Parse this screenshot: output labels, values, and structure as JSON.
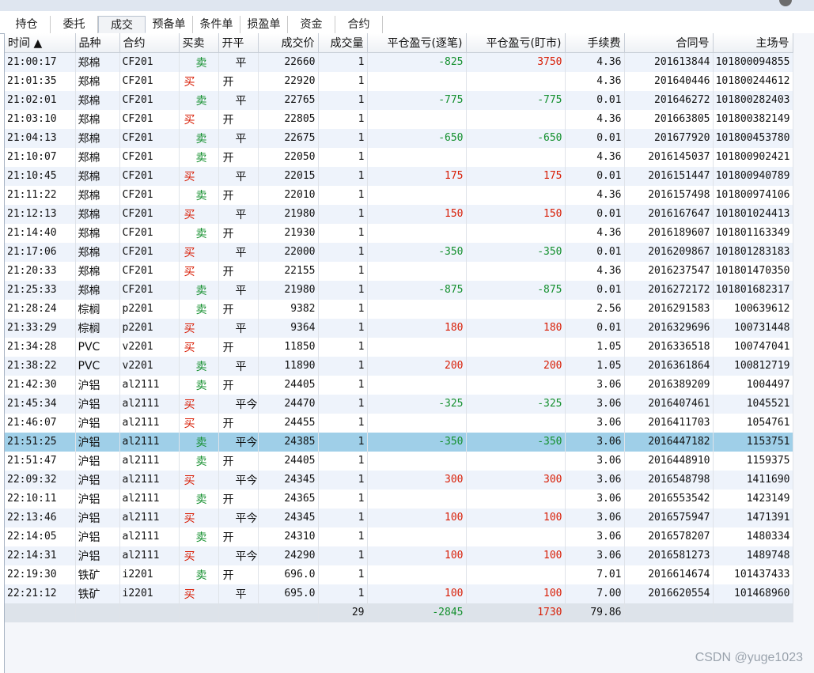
{
  "tabs": [
    {
      "label": "持仓",
      "active": false
    },
    {
      "label": "委托",
      "active": false
    },
    {
      "label": "成交",
      "active": true
    },
    {
      "label": "预备单",
      "active": false
    },
    {
      "label": "条件单",
      "active": false
    },
    {
      "label": "损盈单",
      "active": false
    },
    {
      "label": "资金",
      "active": false
    },
    {
      "label": "合约",
      "active": false
    }
  ],
  "columns": [
    "时间",
    "品种",
    "合约",
    "买卖",
    "开平",
    "成交价",
    "成交量",
    "平仓盈亏(逐笔)",
    "平仓盈亏(盯市)",
    "手续费",
    "合同号",
    "主场号"
  ],
  "sort_indicator": "▲",
  "rows": [
    {
      "time": "21:00:17",
      "symbol": "郑棉",
      "contract": "CF201",
      "side": "卖",
      "oc": "平",
      "price": "22660",
      "qty": "1",
      "pnl_trade": "-825",
      "pnl_mtm": "3750",
      "fee": "4.36",
      "order_id": "201613844",
      "exch_id": "101800094855"
    },
    {
      "time": "21:01:35",
      "symbol": "郑棉",
      "contract": "CF201",
      "side": "买",
      "oc": "开",
      "price": "22920",
      "qty": "1",
      "pnl_trade": "",
      "pnl_mtm": "",
      "fee": "4.36",
      "order_id": "201640446",
      "exch_id": "101800244612"
    },
    {
      "time": "21:02:01",
      "symbol": "郑棉",
      "contract": "CF201",
      "side": "卖",
      "oc": "平",
      "price": "22765",
      "qty": "1",
      "pnl_trade": "-775",
      "pnl_mtm": "-775",
      "fee": "0.01",
      "order_id": "201646272",
      "exch_id": "101800282403"
    },
    {
      "time": "21:03:10",
      "symbol": "郑棉",
      "contract": "CF201",
      "side": "买",
      "oc": "开",
      "price": "22805",
      "qty": "1",
      "pnl_trade": "",
      "pnl_mtm": "",
      "fee": "4.36",
      "order_id": "201663805",
      "exch_id": "101800382149"
    },
    {
      "time": "21:04:13",
      "symbol": "郑棉",
      "contract": "CF201",
      "side": "卖",
      "oc": "平",
      "price": "22675",
      "qty": "1",
      "pnl_trade": "-650",
      "pnl_mtm": "-650",
      "fee": "0.01",
      "order_id": "201677920",
      "exch_id": "101800453780"
    },
    {
      "time": "21:10:07",
      "symbol": "郑棉",
      "contract": "CF201",
      "side": "卖",
      "oc": "开",
      "price": "22050",
      "qty": "1",
      "pnl_trade": "",
      "pnl_mtm": "",
      "fee": "4.36",
      "order_id": "2016145037",
      "exch_id": "101800902421"
    },
    {
      "time": "21:10:45",
      "symbol": "郑棉",
      "contract": "CF201",
      "side": "买",
      "oc": "平",
      "price": "22015",
      "qty": "1",
      "pnl_trade": "175",
      "pnl_mtm": "175",
      "fee": "0.01",
      "order_id": "2016151447",
      "exch_id": "101800940789"
    },
    {
      "time": "21:11:22",
      "symbol": "郑棉",
      "contract": "CF201",
      "side": "卖",
      "oc": "开",
      "price": "22010",
      "qty": "1",
      "pnl_trade": "",
      "pnl_mtm": "",
      "fee": "4.36",
      "order_id": "2016157498",
      "exch_id": "101800974106"
    },
    {
      "time": "21:12:13",
      "symbol": "郑棉",
      "contract": "CF201",
      "side": "买",
      "oc": "平",
      "price": "21980",
      "qty": "1",
      "pnl_trade": "150",
      "pnl_mtm": "150",
      "fee": "0.01",
      "order_id": "2016167647",
      "exch_id": "101801024413"
    },
    {
      "time": "21:14:40",
      "symbol": "郑棉",
      "contract": "CF201",
      "side": "卖",
      "oc": "开",
      "price": "21930",
      "qty": "1",
      "pnl_trade": "",
      "pnl_mtm": "",
      "fee": "4.36",
      "order_id": "2016189607",
      "exch_id": "101801163349"
    },
    {
      "time": "21:17:06",
      "symbol": "郑棉",
      "contract": "CF201",
      "side": "买",
      "oc": "平",
      "price": "22000",
      "qty": "1",
      "pnl_trade": "-350",
      "pnl_mtm": "-350",
      "fee": "0.01",
      "order_id": "2016209867",
      "exch_id": "101801283183"
    },
    {
      "time": "21:20:33",
      "symbol": "郑棉",
      "contract": "CF201",
      "side": "买",
      "oc": "开",
      "price": "22155",
      "qty": "1",
      "pnl_trade": "",
      "pnl_mtm": "",
      "fee": "4.36",
      "order_id": "2016237547",
      "exch_id": "101801470350"
    },
    {
      "time": "21:25:33",
      "symbol": "郑棉",
      "contract": "CF201",
      "side": "卖",
      "oc": "平",
      "price": "21980",
      "qty": "1",
      "pnl_trade": "-875",
      "pnl_mtm": "-875",
      "fee": "0.01",
      "order_id": "2016272172",
      "exch_id": "101801682317"
    },
    {
      "time": "21:28:24",
      "symbol": "棕榈",
      "contract": "p2201",
      "side": "卖",
      "oc": "开",
      "price": "9382",
      "qty": "1",
      "pnl_trade": "",
      "pnl_mtm": "",
      "fee": "2.56",
      "order_id": "2016291583",
      "exch_id": "100639612"
    },
    {
      "time": "21:33:29",
      "symbol": "棕榈",
      "contract": "p2201",
      "side": "买",
      "oc": "平",
      "price": "9364",
      "qty": "1",
      "pnl_trade": "180",
      "pnl_mtm": "180",
      "fee": "0.01",
      "order_id": "2016329696",
      "exch_id": "100731448"
    },
    {
      "time": "21:34:28",
      "symbol": "PVC",
      "contract": "v2201",
      "side": "买",
      "oc": "开",
      "price": "11850",
      "qty": "1",
      "pnl_trade": "",
      "pnl_mtm": "",
      "fee": "1.05",
      "order_id": "2016336518",
      "exch_id": "100747041"
    },
    {
      "time": "21:38:22",
      "symbol": "PVC",
      "contract": "v2201",
      "side": "卖",
      "oc": "平",
      "price": "11890",
      "qty": "1",
      "pnl_trade": "200",
      "pnl_mtm": "200",
      "fee": "1.05",
      "order_id": "2016361864",
      "exch_id": "100812719"
    },
    {
      "time": "21:42:30",
      "symbol": "沪铝",
      "contract": "al2111",
      "side": "卖",
      "oc": "开",
      "price": "24405",
      "qty": "1",
      "pnl_trade": "",
      "pnl_mtm": "",
      "fee": "3.06",
      "order_id": "2016389209",
      "exch_id": "1004497"
    },
    {
      "time": "21:45:34",
      "symbol": "沪铝",
      "contract": "al2111",
      "side": "买",
      "oc": "平今",
      "price": "24470",
      "qty": "1",
      "pnl_trade": "-325",
      "pnl_mtm": "-325",
      "fee": "3.06",
      "order_id": "2016407461",
      "exch_id": "1045521"
    },
    {
      "time": "21:46:07",
      "symbol": "沪铝",
      "contract": "al2111",
      "side": "买",
      "oc": "开",
      "price": "24455",
      "qty": "1",
      "pnl_trade": "",
      "pnl_mtm": "",
      "fee": "3.06",
      "order_id": "2016411703",
      "exch_id": "1054761"
    },
    {
      "time": "21:51:25",
      "symbol": "沪铝",
      "contract": "al2111",
      "side": "卖",
      "oc": "平今",
      "price": "24385",
      "qty": "1",
      "pnl_trade": "-350",
      "pnl_mtm": "-350",
      "fee": "3.06",
      "order_id": "2016447182",
      "exch_id": "1153751",
      "selected": true
    },
    {
      "time": "21:51:47",
      "symbol": "沪铝",
      "contract": "al2111",
      "side": "卖",
      "oc": "开",
      "price": "24405",
      "qty": "1",
      "pnl_trade": "",
      "pnl_mtm": "",
      "fee": "3.06",
      "order_id": "2016448910",
      "exch_id": "1159375"
    },
    {
      "time": "22:09:32",
      "symbol": "沪铝",
      "contract": "al2111",
      "side": "买",
      "oc": "平今",
      "price": "24345",
      "qty": "1",
      "pnl_trade": "300",
      "pnl_mtm": "300",
      "fee": "3.06",
      "order_id": "2016548798",
      "exch_id": "1411690"
    },
    {
      "time": "22:10:11",
      "symbol": "沪铝",
      "contract": "al2111",
      "side": "卖",
      "oc": "开",
      "price": "24365",
      "qty": "1",
      "pnl_trade": "",
      "pnl_mtm": "",
      "fee": "3.06",
      "order_id": "2016553542",
      "exch_id": "1423149"
    },
    {
      "time": "22:13:46",
      "symbol": "沪铝",
      "contract": "al2111",
      "side": "买",
      "oc": "平今",
      "price": "24345",
      "qty": "1",
      "pnl_trade": "100",
      "pnl_mtm": "100",
      "fee": "3.06",
      "order_id": "2016575947",
      "exch_id": "1471391"
    },
    {
      "time": "22:14:05",
      "symbol": "沪铝",
      "contract": "al2111",
      "side": "卖",
      "oc": "开",
      "price": "24310",
      "qty": "1",
      "pnl_trade": "",
      "pnl_mtm": "",
      "fee": "3.06",
      "order_id": "2016578207",
      "exch_id": "1480334"
    },
    {
      "time": "22:14:31",
      "symbol": "沪铝",
      "contract": "al2111",
      "side": "买",
      "oc": "平今",
      "price": "24290",
      "qty": "1",
      "pnl_trade": "100",
      "pnl_mtm": "100",
      "fee": "3.06",
      "order_id": "2016581273",
      "exch_id": "1489748"
    },
    {
      "time": "22:19:30",
      "symbol": "铁矿",
      "contract": "i2201",
      "side": "卖",
      "oc": "开",
      "price": "696.0",
      "qty": "1",
      "pnl_trade": "",
      "pnl_mtm": "",
      "fee": "7.01",
      "order_id": "2016614674",
      "exch_id": "101437433"
    },
    {
      "time": "22:21:12",
      "symbol": "铁矿",
      "contract": "i2201",
      "side": "买",
      "oc": "平",
      "price": "695.0",
      "qty": "1",
      "pnl_trade": "100",
      "pnl_mtm": "100",
      "fee": "7.00",
      "order_id": "2016620554",
      "exch_id": "101468960"
    }
  ],
  "totals": {
    "qty": "29",
    "pnl_trade": "-2845",
    "pnl_mtm": "1730",
    "fee": "79.86"
  },
  "watermark": "CSDN @yuge1023",
  "colors": {
    "buy": "#d81e06",
    "sell": "#138f2d",
    "selected_row": "#9fcfe8",
    "row_stripe": "#eef3fb"
  }
}
